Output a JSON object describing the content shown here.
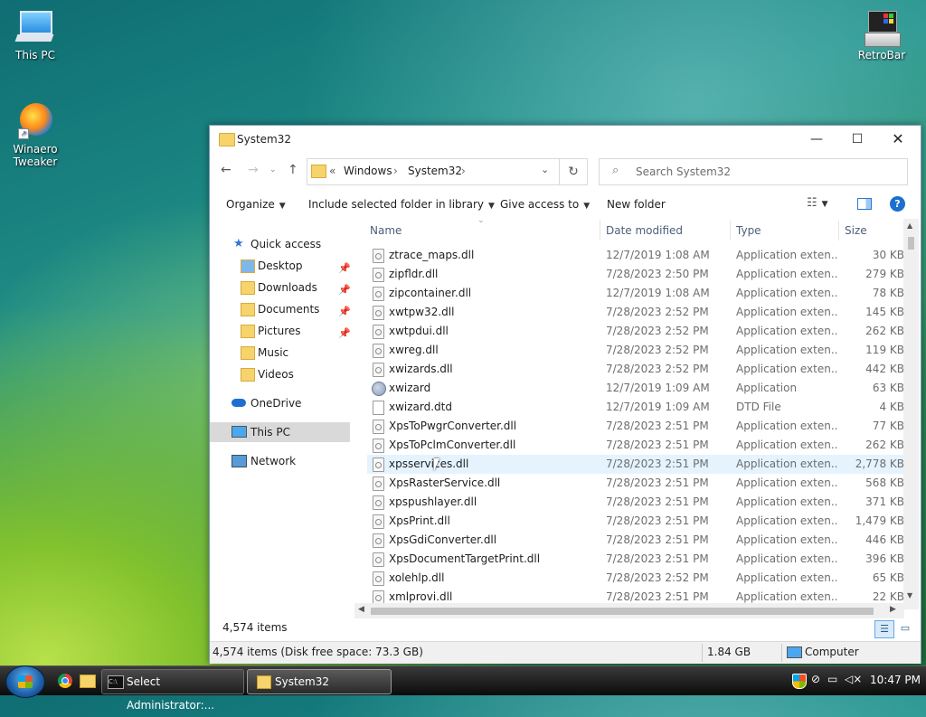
{
  "desktop": {
    "icons": [
      {
        "label": "This PC"
      },
      {
        "label": "Winaero Tweaker"
      },
      {
        "label": "RetroBar"
      }
    ]
  },
  "window": {
    "title": "System32",
    "breadcrumb": [
      "«",
      "Windows",
      "System32"
    ],
    "search_placeholder": "Search System32",
    "toolbar": {
      "organize": "Organize",
      "include": "Include selected folder in library",
      "give_access": "Give access to",
      "new_folder": "New folder"
    },
    "nav": {
      "quick_access": "Quick access",
      "items": [
        "Desktop",
        "Downloads",
        "Documents",
        "Pictures",
        "Music",
        "Videos"
      ],
      "onedrive": "OneDrive",
      "this_pc": "This PC",
      "network": "Network"
    },
    "columns": {
      "name": "Name",
      "date": "Date modified",
      "type": "Type",
      "size": "Size"
    },
    "files": [
      {
        "name": "ztrace_maps.dll",
        "date": "12/7/2019 1:08 AM",
        "type": "Application exten...",
        "size": "30 KB",
        "kind": "dll"
      },
      {
        "name": "zipfldr.dll",
        "date": "7/28/2023 2:50 PM",
        "type": "Application exten...",
        "size": "279 KB",
        "kind": "dll"
      },
      {
        "name": "zipcontainer.dll",
        "date": "12/7/2019 1:08 AM",
        "type": "Application exten...",
        "size": "78 KB",
        "kind": "dll"
      },
      {
        "name": "xwtpw32.dll",
        "date": "7/28/2023 2:52 PM",
        "type": "Application exten...",
        "size": "145 KB",
        "kind": "dll"
      },
      {
        "name": "xwtpdui.dll",
        "date": "7/28/2023 2:52 PM",
        "type": "Application exten...",
        "size": "262 KB",
        "kind": "dll"
      },
      {
        "name": "xwreg.dll",
        "date": "7/28/2023 2:52 PM",
        "type": "Application exten...",
        "size": "119 KB",
        "kind": "dll"
      },
      {
        "name": "xwizards.dll",
        "date": "7/28/2023 2:52 PM",
        "type": "Application exten...",
        "size": "442 KB",
        "kind": "dll"
      },
      {
        "name": "xwizard",
        "date": "12/7/2019 1:09 AM",
        "type": "Application",
        "size": "63 KB",
        "kind": "exe"
      },
      {
        "name": "xwizard.dtd",
        "date": "12/7/2019 1:09 AM",
        "type": "DTD File",
        "size": "4 KB",
        "kind": "dtd"
      },
      {
        "name": "XpsToPwgrConverter.dll",
        "date": "7/28/2023 2:51 PM",
        "type": "Application exten...",
        "size": "77 KB",
        "kind": "dll"
      },
      {
        "name": "XpsToPclmConverter.dll",
        "date": "7/28/2023 2:51 PM",
        "type": "Application exten...",
        "size": "262 KB",
        "kind": "dll"
      },
      {
        "name": "xpsservices.dll",
        "date": "7/28/2023 2:51 PM",
        "type": "Application exten...",
        "size": "2,778 KB",
        "kind": "dll"
      },
      {
        "name": "XpsRasterService.dll",
        "date": "7/28/2023 2:51 PM",
        "type": "Application exten...",
        "size": "568 KB",
        "kind": "dll"
      },
      {
        "name": "xpspushlayer.dll",
        "date": "7/28/2023 2:51 PM",
        "type": "Application exten...",
        "size": "371 KB",
        "kind": "dll"
      },
      {
        "name": "XpsPrint.dll",
        "date": "7/28/2023 2:51 PM",
        "type": "Application exten...",
        "size": "1,479 KB",
        "kind": "dll"
      },
      {
        "name": "XpsGdiConverter.dll",
        "date": "7/28/2023 2:51 PM",
        "type": "Application exten...",
        "size": "446 KB",
        "kind": "dll"
      },
      {
        "name": "XpsDocumentTargetPrint.dll",
        "date": "7/28/2023 2:51 PM",
        "type": "Application exten...",
        "size": "396 KB",
        "kind": "dll"
      },
      {
        "name": "xolehlp.dll",
        "date": "7/28/2023 2:52 PM",
        "type": "Application exten...",
        "size": "65 KB",
        "kind": "dll"
      },
      {
        "name": "xmlprovi.dll",
        "date": "7/28/2023 2:51 PM",
        "type": "Application exten...",
        "size": "22 KB",
        "kind": "dll"
      }
    ],
    "hover_index": 11,
    "item_count": "4,574 items",
    "status": {
      "summary": "4,574 items (Disk free space: 73.3 GB)",
      "size": "1.84 GB",
      "location": "Computer"
    }
  },
  "taskbar": {
    "tasks": [
      "Select Administrator:...",
      "System32"
    ],
    "clock": "10:47 PM"
  }
}
